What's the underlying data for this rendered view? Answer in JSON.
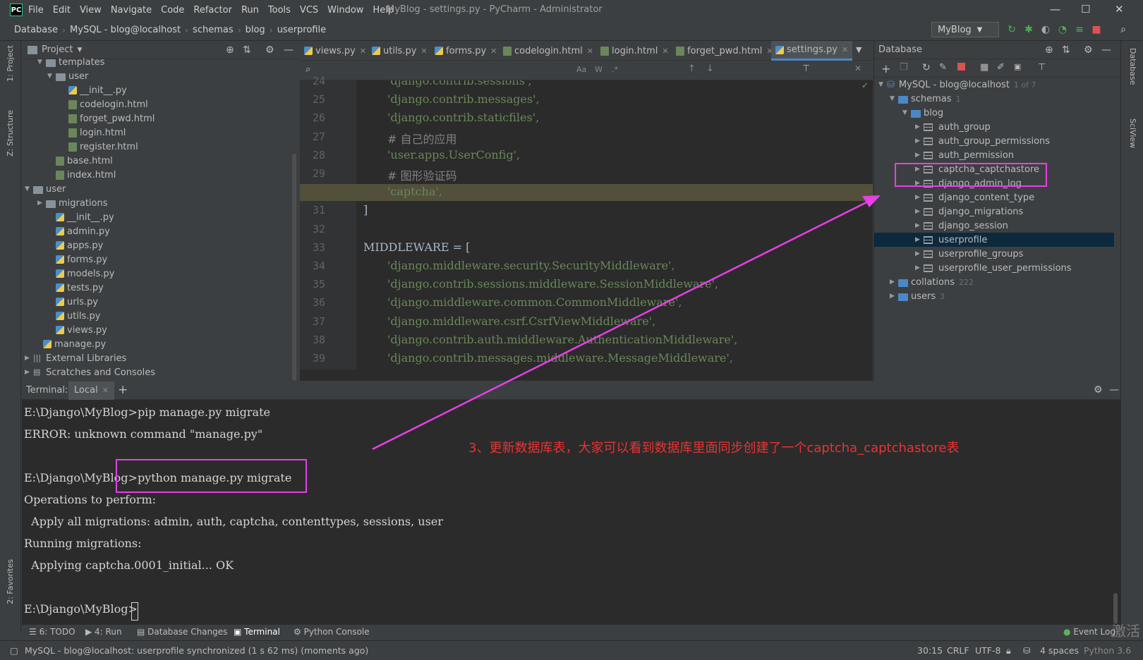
{
  "menubar": {
    "logo": "PC",
    "items": [
      "File",
      "Edit",
      "View",
      "Navigate",
      "Code",
      "Refactor",
      "Run",
      "Tools",
      "VCS",
      "Window",
      "Help"
    ],
    "title": "MyBlog - settings.py - PyCharm - Administrator"
  },
  "nav": {
    "crumbs": [
      "Database",
      "MySQL - blog@localhost",
      "schemas",
      "blog",
      "userprofile"
    ],
    "run_config": "MyBlog"
  },
  "side_tabs": {
    "project": "1: Project",
    "structure": "Z: Structure",
    "favorites": "2: Favorites",
    "database": "Database",
    "sciview": "SciView"
  },
  "project": {
    "header": "Project",
    "rows": [
      "templates",
      "user",
      "__init__.py",
      "codelogin.html",
      "forget_pwd.html",
      "login.html",
      "register.html",
      "base.html",
      "index.html",
      "user",
      "migrations",
      "__init__.py",
      "admin.py",
      "apps.py",
      "forms.py",
      "models.py",
      "tests.py",
      "urls.py",
      "utils.py",
      "views.py",
      "manage.py",
      "External Libraries",
      "Scratches and Consoles"
    ]
  },
  "editor": {
    "tabs": [
      "views.py",
      "utils.py",
      "forms.py",
      "codelogin.html",
      "login.html",
      "forget_pwd.html",
      "settings.py"
    ],
    "lines": [
      {
        "n": "24",
        "t": "'django.contrib.sessions',"
      },
      {
        "n": "25",
        "t": "'django.contrib.messages',"
      },
      {
        "n": "26",
        "t": "'django.contrib.staticfiles',"
      },
      {
        "n": "27",
        "t": "# 自己的应用"
      },
      {
        "n": "28",
        "t": "'user.apps.UserConfig',"
      },
      {
        "n": "29",
        "t": "# 图形验证码"
      },
      {
        "n": "30",
        "t": "'captcha',"
      },
      {
        "n": "31",
        "t": "]"
      },
      {
        "n": "32",
        "t": ""
      },
      {
        "n": "33",
        "t": "MIDDLEWARE = ["
      },
      {
        "n": "34",
        "t": "'django.middleware.security.SecurityMiddleware',"
      },
      {
        "n": "35",
        "t": "'django.contrib.sessions.middleware.SessionMiddleware',"
      },
      {
        "n": "36",
        "t": "'django.middleware.common.CommonMiddleware',"
      },
      {
        "n": "37",
        "t": "'django.middleware.csrf.CsrfViewMiddleware',"
      },
      {
        "n": "38",
        "t": "'django.contrib.auth.middleware.AuthenticationMiddleware',"
      },
      {
        "n": "39",
        "t": "'django.contrib.messages.middleware.MessageMiddleware',"
      }
    ]
  },
  "database": {
    "header": "Database",
    "root": "MySQL - blog@localhost",
    "root_count": "1 of 7",
    "schemas": "schemas",
    "schemas_count": "1",
    "blog": "blog",
    "tables": [
      "auth_group",
      "auth_group_permissions",
      "auth_permission",
      "captcha_captchastore",
      "django_admin_log",
      "django_content_type",
      "django_migrations",
      "django_session",
      "userprofile",
      "userprofile_groups",
      "userprofile_user_permissions"
    ],
    "collations": "collations",
    "collations_count": "222",
    "users": "users",
    "users_count": "3"
  },
  "terminal": {
    "label": "Terminal:",
    "tab": "Local",
    "lines": [
      "E:\\Django\\MyBlog>pip manage.py migrate",
      "ERROR: unknown command \"manage.py\"",
      "",
      "E:\\Django\\MyBlog>python manage.py migrate",
      "Operations to perform:",
      "  Apply all migrations: admin, auth, captcha, contenttypes, sessions, user",
      "Running migrations:",
      "  Applying captcha.0001_initial... OK",
      "",
      "E:\\Django\\MyBlog>"
    ]
  },
  "annotation": "3、更新数据库表，大家可以看到数据库里面同步创建了一个captcha_captchastore表",
  "bottom_tabs": [
    "6: TODO",
    "4: Run",
    "Database Changes",
    "Terminal",
    "Python Console",
    "Event Log"
  ],
  "status": {
    "message": "MySQL - blog@localhost: userprofile synchronized (1 s 62 ms) (moments ago)",
    "pos": "30:15",
    "eol": "CRLF",
    "enc": "UTF-8",
    "indent": "4 spaces",
    "interp": "Python 3.6",
    "watermark": "激活"
  },
  "colors": {
    "annotation": "#e83fe8",
    "text_red": "#e83333",
    "selection": "#0d293e"
  }
}
